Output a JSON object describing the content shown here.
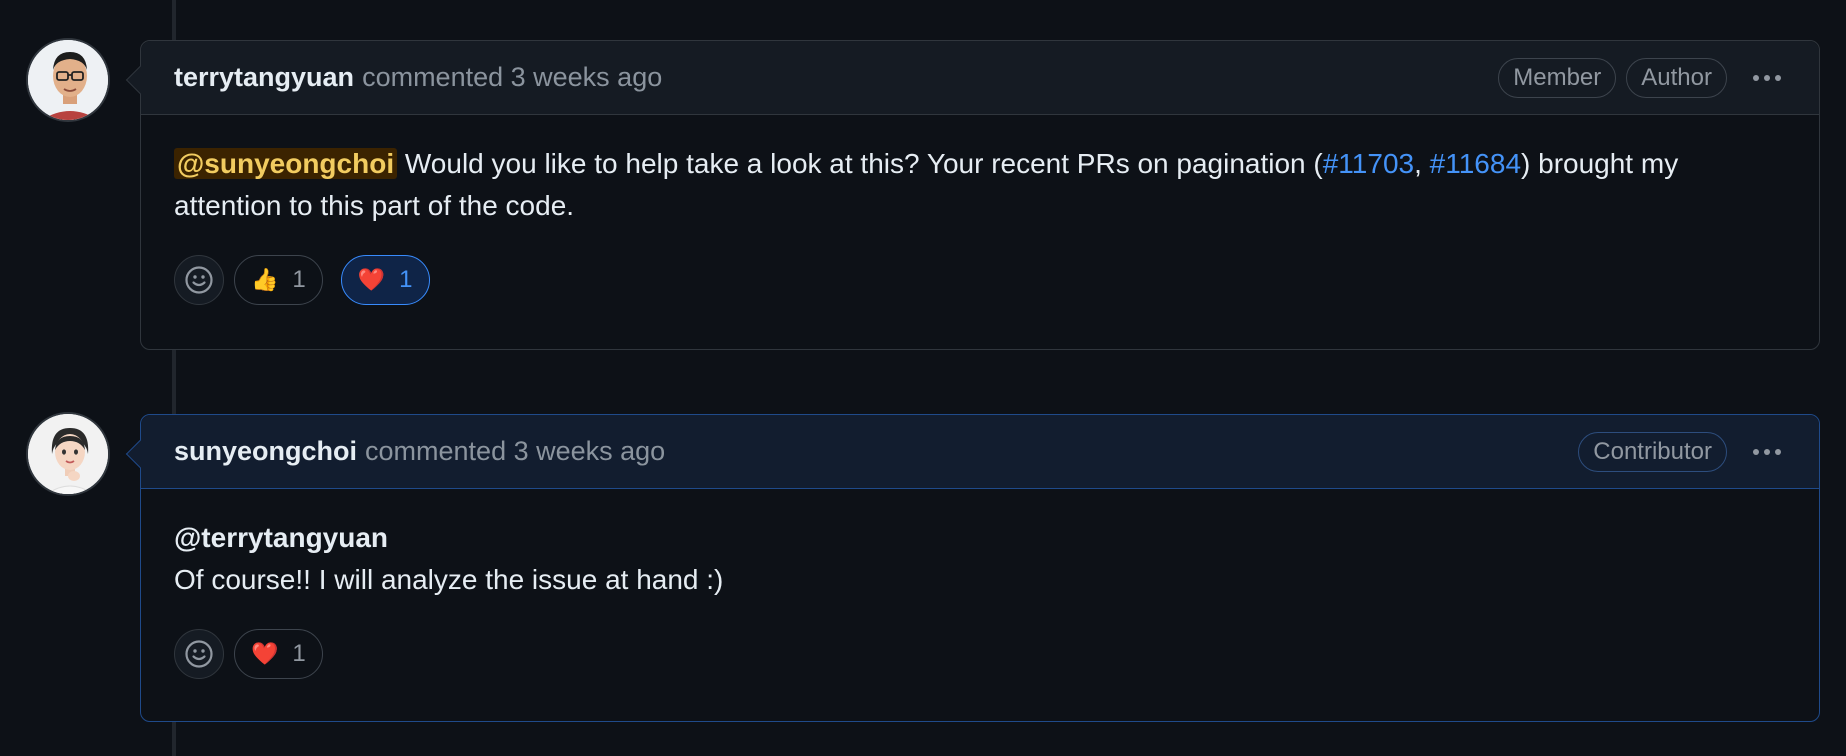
{
  "comments": [
    {
      "author": "terrytangyuan",
      "meta": "commented 3 weeks ago",
      "badges": [
        "Member",
        "Author"
      ],
      "body": {
        "mention": "@sunyeongchoi",
        "text1": " Would you like to help take a look at this? Your recent PRs on pagination (",
        "link1": "#11703",
        "sep": ", ",
        "link2": "#11684",
        "text2": ") brought my attention to this part of the code."
      },
      "reactions": [
        {
          "emoji": "👍",
          "count": "1"
        },
        {
          "emoji": "❤️",
          "count": "1"
        }
      ]
    },
    {
      "author": "sunyeongchoi",
      "meta": "commented 3 weeks ago",
      "badges": [
        "Contributor"
      ],
      "body": {
        "mention": "@terrytangyuan",
        "text": "Of course!! I will analyze the issue at hand :)"
      },
      "reactions": [
        {
          "emoji": "❤️",
          "count": "1"
        }
      ]
    }
  ],
  "icons": {
    "add_reaction": "smiley-icon",
    "more_options": "kebab-horizontal-icon"
  },
  "colors": {
    "background": "#0d1117",
    "link": "#4493f8",
    "mention_highlight_bg": "#3b2300",
    "mention_highlight_fg": "#f2cc60",
    "highlight_border": "#1f4a8a"
  }
}
